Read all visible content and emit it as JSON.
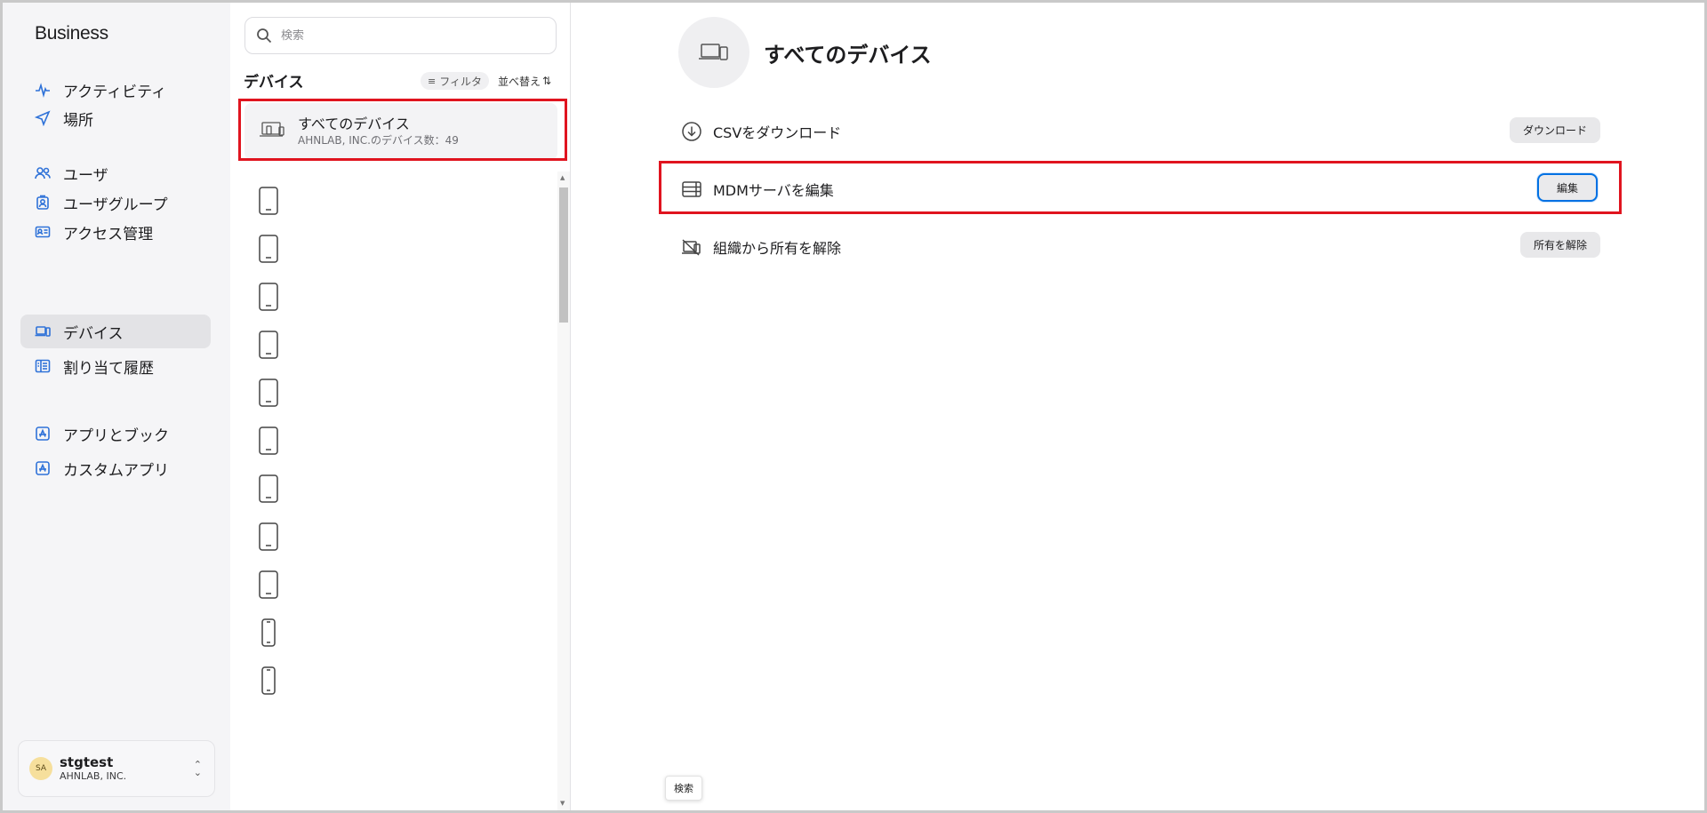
{
  "brand": {
    "apple_glyph": "",
    "name": "Business"
  },
  "sidebar": {
    "items": [
      {
        "label": "アクティビティ",
        "icon": "activity-icon"
      },
      {
        "label": "場所",
        "icon": "location-arrow-icon"
      },
      {
        "label": "ユーザ",
        "icon": "users-icon"
      },
      {
        "label": "ユーザグループ",
        "icon": "user-group-icon"
      },
      {
        "label": "アクセス管理",
        "icon": "id-card-icon"
      },
      {
        "label": "デバイス",
        "icon": "laptop-phone-icon",
        "active": true
      },
      {
        "label": "割り当て履歴",
        "icon": "history-list-icon"
      },
      {
        "label": "アプリとブック",
        "icon": "app-store-icon"
      },
      {
        "label": "カスタムアプリ",
        "icon": "app-store-icon"
      }
    ],
    "account": {
      "initials": "SA",
      "name": "stgtest",
      "org": "AHNLAB, INC."
    }
  },
  "list": {
    "search_placeholder": "検索",
    "title": "デバイス",
    "filter_label": "フィルタ",
    "sort_label": "並べ替え",
    "all_devices": {
      "title": "すべてのデバイス",
      "subtitle": "AHNLAB, INC.のデバイス数：49"
    },
    "device_icons": [
      "tablet-icon",
      "tablet-icon",
      "tablet-icon",
      "tablet-icon",
      "tablet-icon",
      "tablet-icon",
      "tablet-icon",
      "tablet-icon",
      "tablet-icon",
      "phone-icon",
      "phone-icon"
    ]
  },
  "detail": {
    "title": "すべてのデバイス",
    "actions": [
      {
        "label": "CSVをダウンロード",
        "button": "ダウンロード",
        "icon": "download-circle-icon"
      },
      {
        "label": "MDMサーバを編集",
        "button": "編集",
        "icon": "server-icon"
      },
      {
        "label": "組織から所有を解除",
        "button": "所有を解除",
        "icon": "release-device-icon"
      }
    ]
  },
  "tooltip": "検索",
  "colors": {
    "accent": "#2f72d8",
    "highlight": "#e0141f",
    "focus": "#0071e3"
  }
}
